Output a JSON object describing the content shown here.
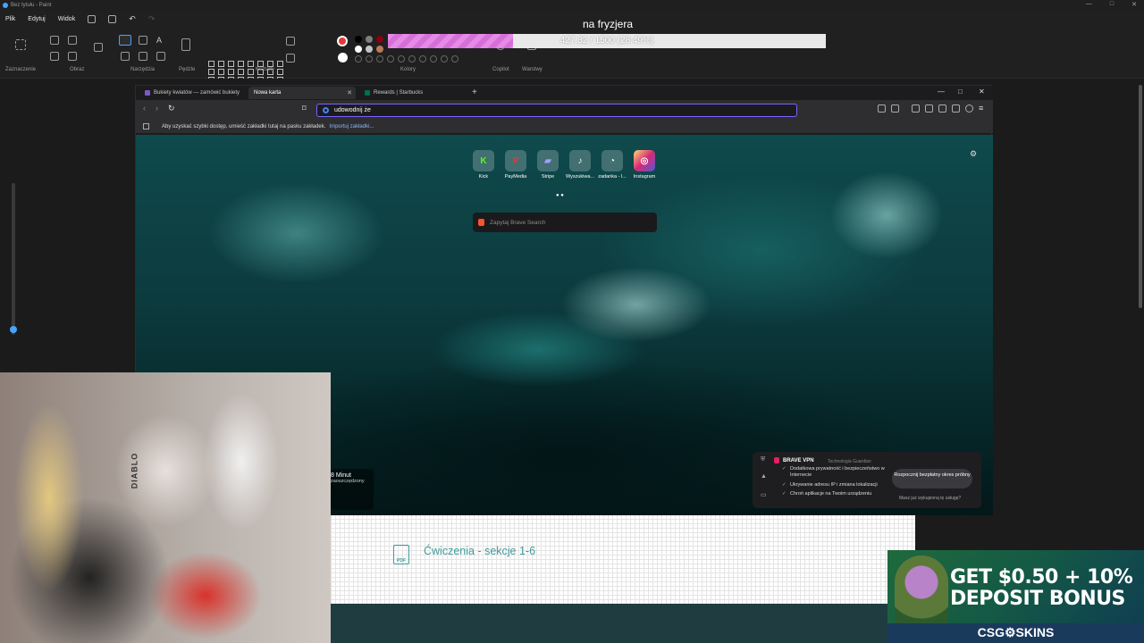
{
  "paint": {
    "window_title": "Bez tytułu - Paint",
    "menu": [
      "Plik",
      "Edytuj",
      "Widok"
    ],
    "groups": [
      "Zaznaczenie",
      "Obraz",
      "Narzędzia",
      "Pędzle",
      "Kształty",
      "Kolory",
      "Copilot",
      "Warstwy"
    ]
  },
  "overlay": {
    "title": "na fryzjera",
    "progress_text": "427.32 / 1500 (28.49%)",
    "progress_fraction": 0.2849,
    "progress_color": "#e58ae6"
  },
  "browser": {
    "tabs": [
      {
        "label": "Bukiety kwiatów — zamówić bukiety",
        "favicon_color": "#7e57c2",
        "active": false
      },
      {
        "label": "Nowa karta",
        "favicon_color": "#4a4a4a",
        "active": true
      },
      {
        "label": "Rewards | Starbucks",
        "favicon_color": "#00704a",
        "active": false
      }
    ],
    "new_tab": "+",
    "url": "udowodnij że",
    "bookmarks_hint": "Aby uzyskać szybki dostęp, umieść zakładki tutaj na pasku zakładek.",
    "bookmarks_link": "Importuj zakładki...",
    "accent_color": "#7b61ff",
    "top_sites": [
      {
        "label": "Kick",
        "glyph": "K",
        "color": "#53fc18"
      },
      {
        "label": "PayMedia",
        "glyph": "P",
        "color": "#e53935"
      },
      {
        "label": "Stripe",
        "glyph": "▰",
        "color": "#635bff"
      },
      {
        "label": "Wyszukiwa...",
        "glyph": "♪",
        "color": "#111111"
      },
      {
        "label": "zadanka - l...",
        "glyph": "◔",
        "color": "#ffffff"
      },
      {
        "label": "Instagram",
        "glyph": "◎",
        "color": "#d62976"
      }
    ],
    "search_placeholder": "Zapytaj Brave Search",
    "widget_time": "8 Minut",
    "widget_sub": "zaoszczędzony",
    "vpn": {
      "title": "BRAVE VPN",
      "subtitle": "Technologia Guardian",
      "features": [
        "Dodatkowa prywatność i bezpieczeństwo w Internecie",
        "Ukrywanie adresu IP i zmiana lokalizacji",
        "Chroń aplikacje na Twoim urządzeniu"
      ],
      "cta": "Rozpocznij bezpłatny okres próbny",
      "link": "Masz już wykupioną tę usługę?"
    }
  },
  "underlying_page": {
    "pdf_label": "PDF",
    "link_text": "Ćwiczenia - sekcje 1-6"
  },
  "webcam": {
    "chair_text": "DIABLO"
  },
  "ad": {
    "line1": "GET $0.50 + 10%",
    "line2": "DEPOSIT BONUS",
    "brand": "CSG⚙SKINS"
  }
}
